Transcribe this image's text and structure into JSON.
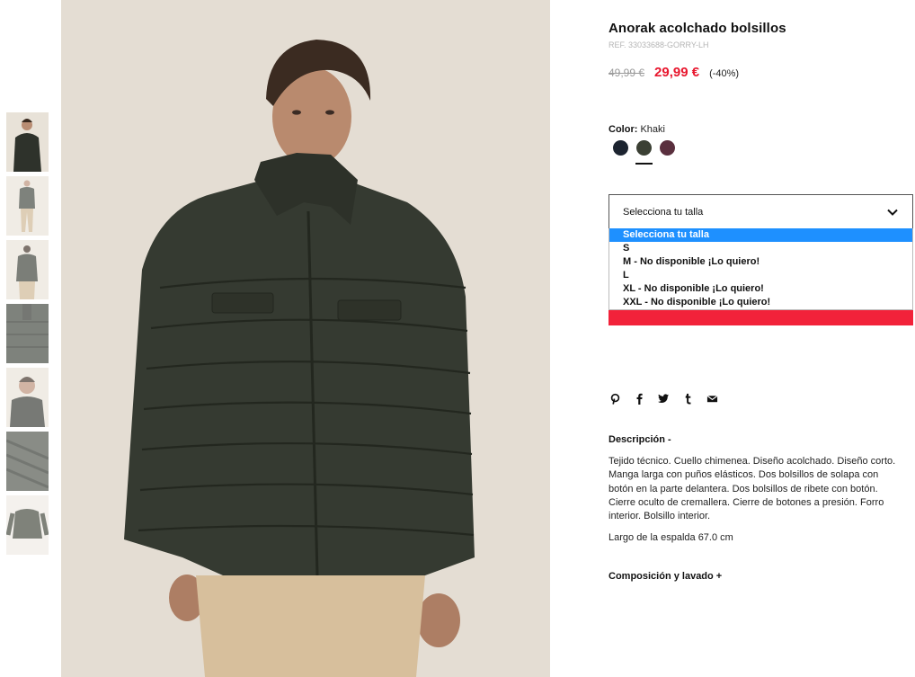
{
  "product": {
    "title": "Anorak acolchado bolsillos",
    "ref": "REF. 33033688-GORRY-LH",
    "old_price": "49,99 €",
    "new_price": "29,99 €",
    "discount": "(-40%)"
  },
  "color": {
    "label": "Color:",
    "value": "Khaki",
    "swatches": [
      {
        "name": "navy",
        "hex": "#1c2430"
      },
      {
        "name": "khaki",
        "hex": "#3b4034"
      },
      {
        "name": "burgundy",
        "hex": "#5a2f3e"
      }
    ],
    "selected_index": 1
  },
  "size": {
    "placeholder": "Selecciona tu talla",
    "options": [
      "Selecciona tu talla",
      "S",
      "M - No disponible ¡Lo quiero!",
      "L",
      "XL - No disponible ¡Lo quiero!",
      "XXL - No disponible ¡Lo quiero!"
    ]
  },
  "share": {
    "icons": [
      "pinterest-icon",
      "facebook-icon",
      "twitter-icon",
      "tumblr-icon",
      "email-icon"
    ]
  },
  "description": {
    "heading": "Descripción -",
    "text": "Tejido técnico. Cuello chimenea. Diseño acolchado. Diseño corto. Manga larga con puños elásticos. Dos bolsillos de solapa con botón en la parte delantera. Dos bolsillos de ribete con botón. Cierre oculto de cremallera. Cierre de botones a presión. Forro interior. Bolsillo interior.",
    "length": "Largo de la espalda 67.0 cm"
  },
  "composition": {
    "heading": "Composición y lavado +"
  },
  "colors": {
    "accent_red": "#e8172e",
    "dropdown_highlight": "#1e90ff"
  }
}
